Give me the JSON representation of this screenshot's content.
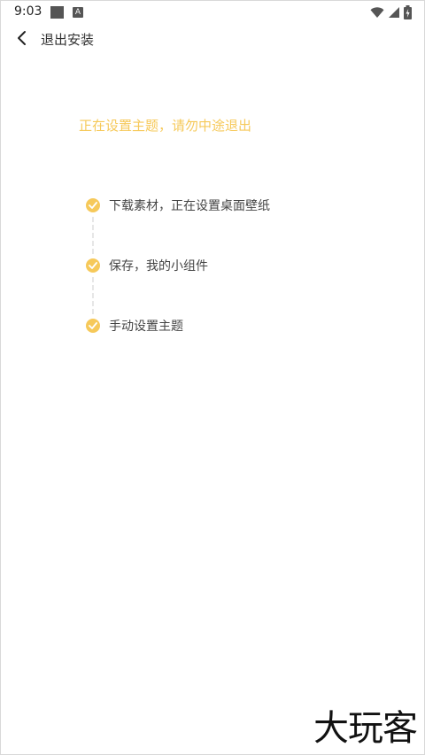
{
  "status_bar": {
    "time": "9:03",
    "notification_badge_letter": "A"
  },
  "app_bar": {
    "title": "退出安装"
  },
  "main": {
    "headline": "正在设置主题，请勿中途退出",
    "steps": [
      {
        "label": "下载素材，正在设置桌面壁纸",
        "done": true
      },
      {
        "label": "保存，我的小组件",
        "done": true
      },
      {
        "label": "手动设置主题",
        "done": true
      }
    ]
  },
  "watermark": "大玩客",
  "colors": {
    "accent": "#f6c95a",
    "text_primary": "#333333",
    "text_secondary": "#444444"
  }
}
